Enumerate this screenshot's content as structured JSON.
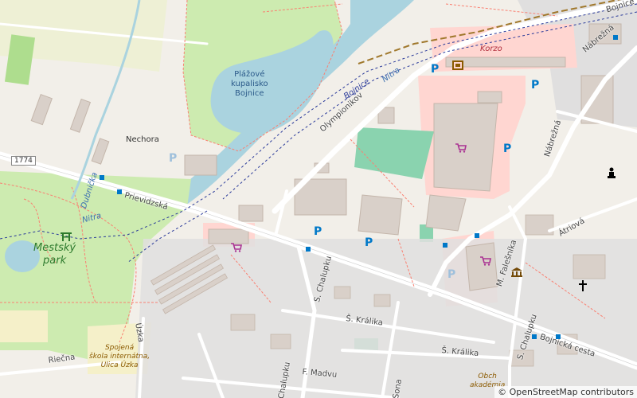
{
  "map": {
    "places": {
      "nechora": "Nechora",
      "lake": [
        "Plážové",
        "kupalisko",
        "Bojnice"
      ],
      "park": [
        "Mestský",
        "park"
      ],
      "school": [
        "Spojená",
        "škola internátna,",
        "Ulica Úzka"
      ],
      "korzo": "Korzo",
      "academy": [
        "Obch",
        "akadémia"
      ]
    },
    "streets": {
      "olympionikov": "Olympionikov",
      "prievidzska": "Prievidzská",
      "nabrezna_top": "Nábrežná",
      "nabrezna": "Nábrežná",
      "atriova": "Átriová",
      "falesnika": "M. Falešníka",
      "chalupku": "S. Chalupku",
      "kralika1": "Š. Králika",
      "kralika2": "Š. Králika",
      "madvu": "F. Madvu",
      "bojnicka": "Bojnická cesta",
      "s_street": "S. Chalupku",
      "uzka": "Úzka",
      "riecna": "Riečna",
      "chalupku2": "Chalupku",
      "sona": "Sona",
      "bojnice_top": "Bojnice",
      "bojnice_river": "Bojnice"
    },
    "rivers": {
      "nitra1": "Nitra",
      "nitra2": "Nitra",
      "dubnicka": "Dubnička"
    },
    "road_number": "1774",
    "parking_symbol": "P",
    "attribution": "© OpenStreetMap contributors",
    "colors": {
      "water": "#aad3df",
      "park": "#cdebb0",
      "pitch": "#8ad3af",
      "retail": "#ffd6d1",
      "building": "#d9d0c9",
      "residential": "#e0dfdf",
      "farmland": "#eef0d5",
      "road": "#ffffff",
      "footway": "#fa8072",
      "railway": "#a0782c",
      "boundary": "#2a3a9a"
    }
  }
}
